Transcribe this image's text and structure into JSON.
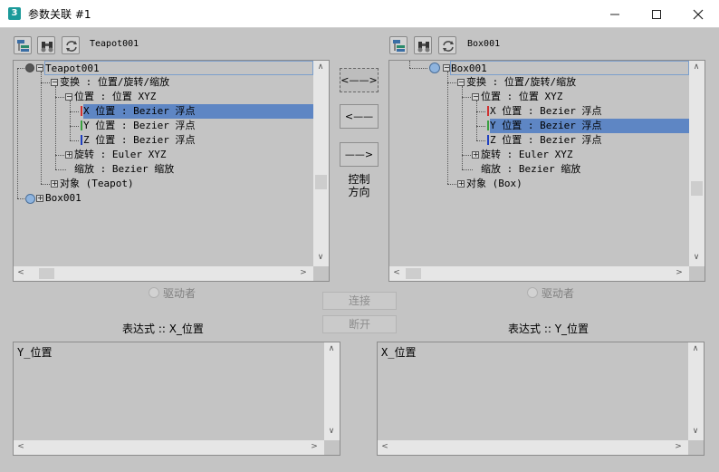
{
  "window": {
    "app_icon": "3",
    "title": "参数关联 #1",
    "minimize_icon": "minimize-icon",
    "maximize_icon": "maximize-icon",
    "close_icon": "close-icon"
  },
  "left": {
    "object_name": "Teapot001",
    "tree": {
      "root": "Teapot001",
      "transform": "变换 : 位置/旋转/缩放",
      "position": "位置 : 位置 XYZ",
      "x_pos": "X 位置 : Bezier 浮点",
      "y_pos": "Y 位置 : Bezier 浮点",
      "z_pos": "Z 位置 : Bezier 浮点",
      "rotation": "旋转 : Euler XYZ",
      "scale": "缩放 : Bezier 缩放",
      "object": "对象 (Teapot)",
      "box": "Box001"
    },
    "driver_label": "驱动者",
    "expression_label": "表达式 :: X_位置",
    "expression_text": "Y_位置"
  },
  "right": {
    "object_name": "Box001",
    "tree": {
      "root": "Box001",
      "transform": "变换 : 位置/旋转/缩放",
      "position": "位置 : 位置 XYZ",
      "x_pos": "X 位置 : Bezier 浮点",
      "y_pos": "Y 位置 : Bezier 浮点",
      "z_pos": "Z 位置 : Bezier 浮点",
      "rotation": "旋转 : Euler XYZ",
      "scale": "缩放 : Bezier 缩放",
      "object": "对象 (Box)"
    },
    "driver_label": "驱动者",
    "expression_label": "表达式 :: Y_位置",
    "expression_text": "X_位置"
  },
  "middle": {
    "bidirectional": "<——>",
    "left_arrow": "<——",
    "right_arrow": "——>",
    "control_direction_line1": "控制",
    "control_direction_line2": "方向",
    "connect": "连接",
    "disconnect": "断开"
  },
  "colors": {
    "selection": "#5e86c4",
    "background": "#c4c4c4",
    "x_color": "#d03030",
    "y_color": "#3aa040",
    "z_color": "#2040c0"
  }
}
